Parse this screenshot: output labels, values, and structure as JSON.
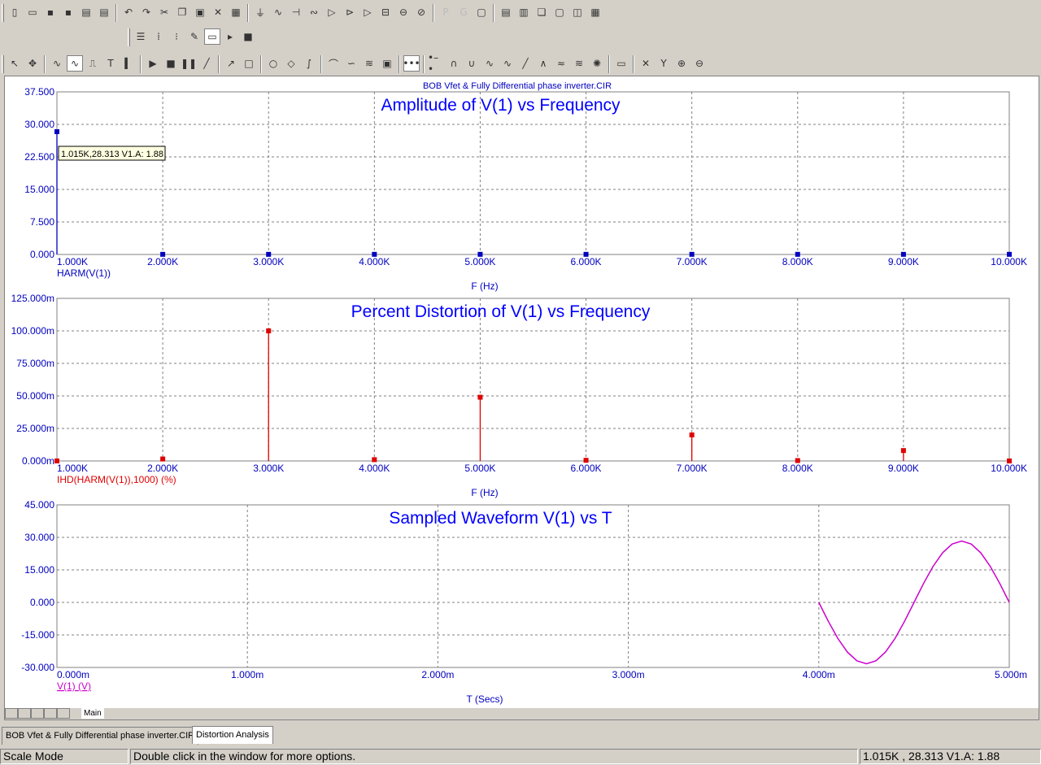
{
  "window": {
    "plot_title": "BOB Vfet & Fully Differential phase inverter.CIR",
    "cursor_tooltip": "1.015K,28.313 V1.A: 1.88"
  },
  "colors": {
    "axis_blue": "#0000c0",
    "title_blue": "#0000ff",
    "distortion_red": "#e00000",
    "waveform_magenta": "#cc00cc",
    "grid": "#808080"
  },
  "plots": [
    {
      "id": "amplitude",
      "title": "Amplitude of V(1) vs Frequency",
      "y_ticks": [
        "37.500",
        "30.000",
        "22.500",
        "15.000",
        "7.500",
        "0.000"
      ],
      "x_ticks": [
        "1.000K",
        "2.000K",
        "3.000K",
        "4.000K",
        "5.000K",
        "6.000K",
        "7.000K",
        "8.000K",
        "9.000K",
        "10.000K"
      ],
      "x_label": "F (Hz)",
      "trace_label": "HARM(V(1))"
    },
    {
      "id": "distortion",
      "title": "Percent Distortion of V(1) vs Frequency",
      "y_ticks": [
        "125.000m",
        "100.000m",
        "75.000m",
        "50.000m",
        "25.000m",
        "0.000m"
      ],
      "x_ticks": [
        "1.000K",
        "2.000K",
        "3.000K",
        "4.000K",
        "5.000K",
        "6.000K",
        "7.000K",
        "8.000K",
        "9.000K",
        "10.000K"
      ],
      "x_label": "F (Hz)",
      "trace_label": "IHD(HARM(V(1)),1000) (%)"
    },
    {
      "id": "waveform",
      "title": "Sampled Waveform  V(1) vs T",
      "y_ticks": [
        "45.000",
        "30.000",
        "15.000",
        "0.000",
        "-15.000",
        "-30.000"
      ],
      "x_ticks": [
        "0.000m",
        "1.000m",
        "2.000m",
        "3.000m",
        "4.000m",
        "5.000m"
      ],
      "x_label": "T (Secs)",
      "trace_label": "V(1) (V)"
    }
  ],
  "chart_data": [
    {
      "type": "bar",
      "title": "Amplitude of V(1) vs Frequency",
      "xlabel": "F (Hz)",
      "ylabel": "HARM(V(1))",
      "x": [
        1000,
        2000,
        3000,
        4000,
        5000,
        6000,
        7000,
        8000,
        9000,
        10000
      ],
      "values": [
        28.313,
        0.03,
        0.03,
        0.03,
        0.03,
        0.03,
        0.03,
        0.03,
        0.03,
        0.03
      ],
      "xlim": [
        1000,
        10000
      ],
      "ylim": [
        0,
        37.5
      ],
      "grid": true
    },
    {
      "type": "bar",
      "title": "Percent Distortion of V(1) vs Frequency",
      "xlabel": "F (Hz)",
      "ylabel": "IHD(HARM(V(1)),1000) (%)",
      "x": [
        1000,
        2000,
        3000,
        4000,
        5000,
        6000,
        7000,
        8000,
        9000,
        10000
      ],
      "values": [
        0,
        1.5,
        100,
        1,
        49,
        0.5,
        20,
        0.3,
        8,
        0
      ],
      "xlim": [
        1000,
        10000
      ],
      "ylim": [
        0,
        125
      ],
      "yunit": "m",
      "grid": true
    },
    {
      "type": "line",
      "title": "Sampled Waveform  V(1) vs T",
      "xlabel": "T (Secs)",
      "ylabel": "V(1) (V)",
      "xunit": "m",
      "x": [
        4.0,
        4.05,
        4.1,
        4.15,
        4.2,
        4.25,
        4.3,
        4.35,
        4.4,
        4.45,
        4.5,
        4.55,
        4.6,
        4.65,
        4.7,
        4.75,
        4.8,
        4.85,
        4.9,
        4.95,
        5.0
      ],
      "series": [
        {
          "values": [
            0,
            -8.75,
            -16.64,
            -22.9,
            -26.93,
            -28.31,
            -26.93,
            -22.9,
            -16.64,
            -8.75,
            0,
            8.75,
            16.64,
            22.9,
            26.93,
            28.31,
            26.93,
            22.9,
            16.64,
            8.75,
            0
          ]
        }
      ],
      "xlim": [
        0,
        5
      ],
      "ylim": [
        -30,
        45
      ],
      "grid": true
    }
  ],
  "bottom_tabs": {
    "sheet_tab": "Main",
    "doc_tabs": [
      "BOB Vfet & Fully Differential phase inverter.CIR",
      "Distortion Analysis"
    ]
  },
  "status": {
    "mode": "Scale Mode",
    "hint": "Double click in the window for more options.",
    "readout": "1.015K , 28.313  V1.A: 1.88"
  },
  "toolbar_icons": {
    "row1": [
      "new-file-icon",
      "open-file-icon",
      "save-icon",
      "save-as-icon",
      "print-preview-icon",
      "print-icon",
      "undo-icon",
      "redo-icon",
      "cut-icon",
      "copy-icon",
      "paste-icon",
      "delete-icon",
      "grid-icon",
      "ground-icon",
      "resistor-icon",
      "capacitor-icon",
      "inductor-icon",
      "diode-icon",
      "transistor-icon",
      "opamp-icon",
      "battery-icon",
      "source-icon",
      "probe-icon",
      "p-text-icon",
      "g-text-icon",
      "window-icon",
      "tile-horizontal-icon",
      "tile-vertical-icon",
      "cascade-icon",
      "maximize-icon",
      "split-icon",
      "calculator-icon"
    ],
    "row2": [
      "properties-icon",
      "align-icon",
      "node-numbers-icon",
      "pin-icon",
      "analysis-limits-icon",
      "run-icon",
      "stop-icon"
    ],
    "row3": [
      "select-arrow-icon",
      "scale-icon",
      "cursor-mode-icon",
      "waveform-icon",
      "pulse-icon",
      "text-icon",
      "line-icon",
      "play-icon",
      "stop-icon",
      "pause-icon",
      "line-tool-icon",
      "arrow-tool-icon",
      "rect-icon",
      "ellipse-icon",
      "diamond-icon",
      "curve-icon",
      "curve2-icon",
      "curve3-icon",
      "curve4-icon",
      "scope-icon",
      "data-points-icon",
      "tokens-icon",
      "peak-icon",
      "valley-icon",
      "high-icon",
      "low-icon",
      "slope-icon",
      "inflection-icon",
      "global-high-icon",
      "global-low-icon",
      "animate-icon",
      "zoom-icon",
      "x-cursor-icon",
      "y-cursor-icon",
      "zoom-in-icon",
      "zoom-out-icon"
    ]
  }
}
